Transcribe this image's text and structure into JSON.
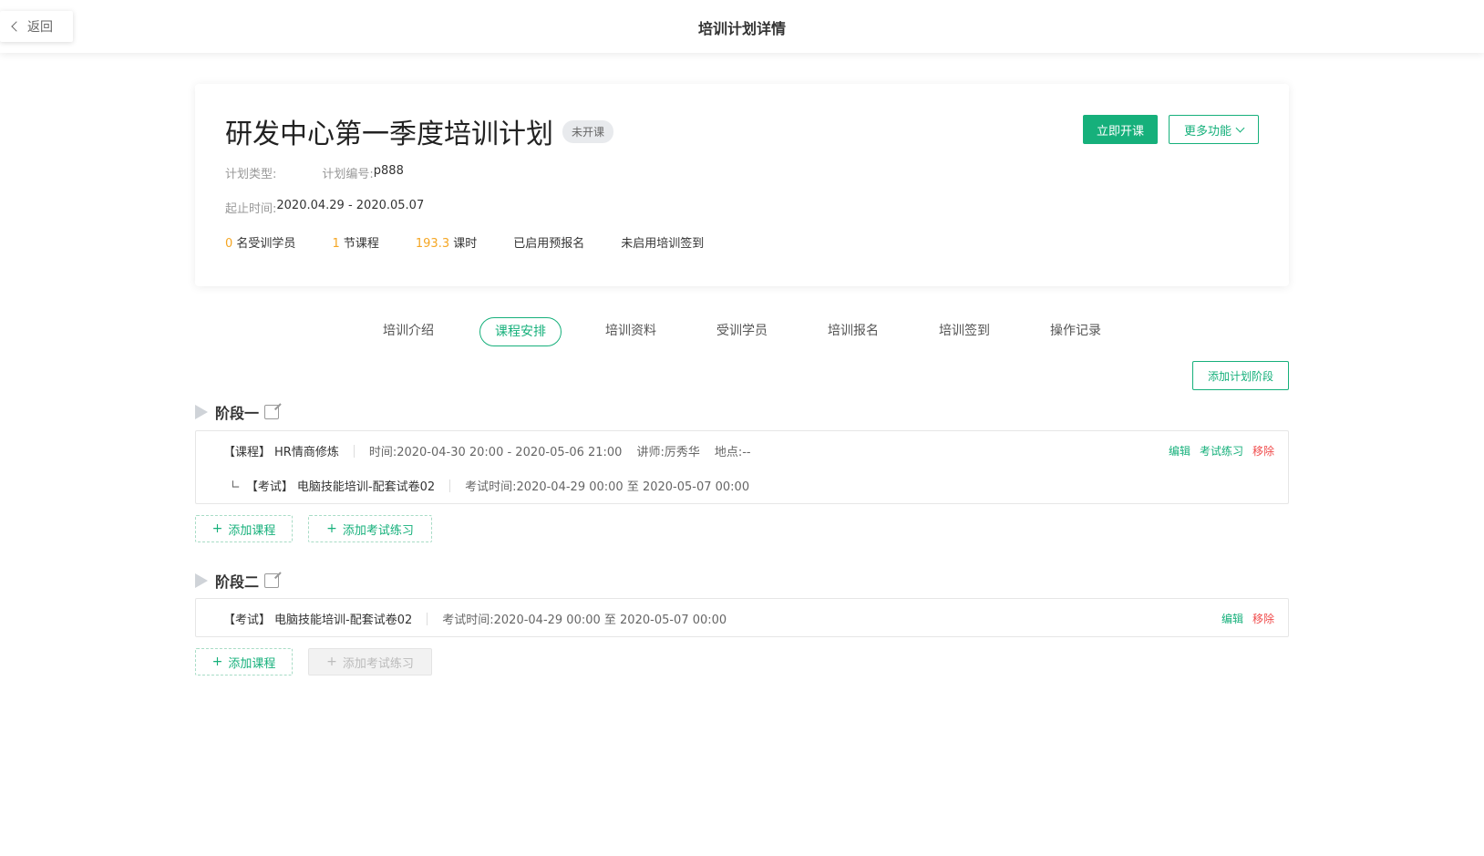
{
  "header": {
    "back_label": "返回",
    "title": "培训计划详情"
  },
  "plan": {
    "title": "研发中心第一季度培训计划",
    "status": "未开课",
    "type_label": "计划类型:",
    "type_value": "",
    "code_label": "计划编号:",
    "code_value": "p888",
    "period_label": "起止时间:",
    "period_value": "2020.04.29 - 2020.05.07",
    "stats": {
      "students_num": "0",
      "students_label": "名受训学员",
      "courses_num": "1",
      "courses_label": "节课程",
      "hours_num": "193.3",
      "hours_label": "课时",
      "pre_signup": "已启用预报名",
      "checkin": "未启用培训签到"
    },
    "start_button": "立即开课",
    "more_button": "更多功能"
  },
  "tabs": [
    {
      "label": "培训介绍"
    },
    {
      "label": "课程安排",
      "active": true
    },
    {
      "label": "培训资料"
    },
    {
      "label": "受训学员"
    },
    {
      "label": "培训报名"
    },
    {
      "label": "培训签到"
    },
    {
      "label": "操作记录"
    }
  ],
  "add_stage_button": "添加计划阶段",
  "stages": [
    {
      "name": "阶段一",
      "items": [
        {
          "tag": "【课程】",
          "title": "HR情商修炼",
          "time": "时间:2020-04-30 20:00 - 2020-05-06 21:00",
          "lecturer": "讲师:厉秀华",
          "location": "地点:--",
          "actions": [
            "编辑",
            "考试练习",
            "移除"
          ]
        },
        {
          "sub_mark": "∟",
          "tag": "【考试】",
          "title": "电脑技能培训-配套试卷02",
          "time": "考试时间:2020-04-29 00:00 至 2020-05-07 00:00"
        }
      ],
      "add_course": "添加课程",
      "add_exam": "添加考试练习"
    },
    {
      "name": "阶段二",
      "items": [
        {
          "tag": "【考试】",
          "title": "电脑技能培训-配套试卷02",
          "time": "考试时间:2020-04-29 00:00 至 2020-05-07 00:00",
          "actions": [
            "编辑",
            "移除"
          ]
        }
      ],
      "add_course": "添加课程",
      "add_exam": "添加考试练习"
    }
  ],
  "colors": {
    "accent": "#16b07b",
    "danger": "#f04b4b",
    "number": "#f5a623"
  }
}
